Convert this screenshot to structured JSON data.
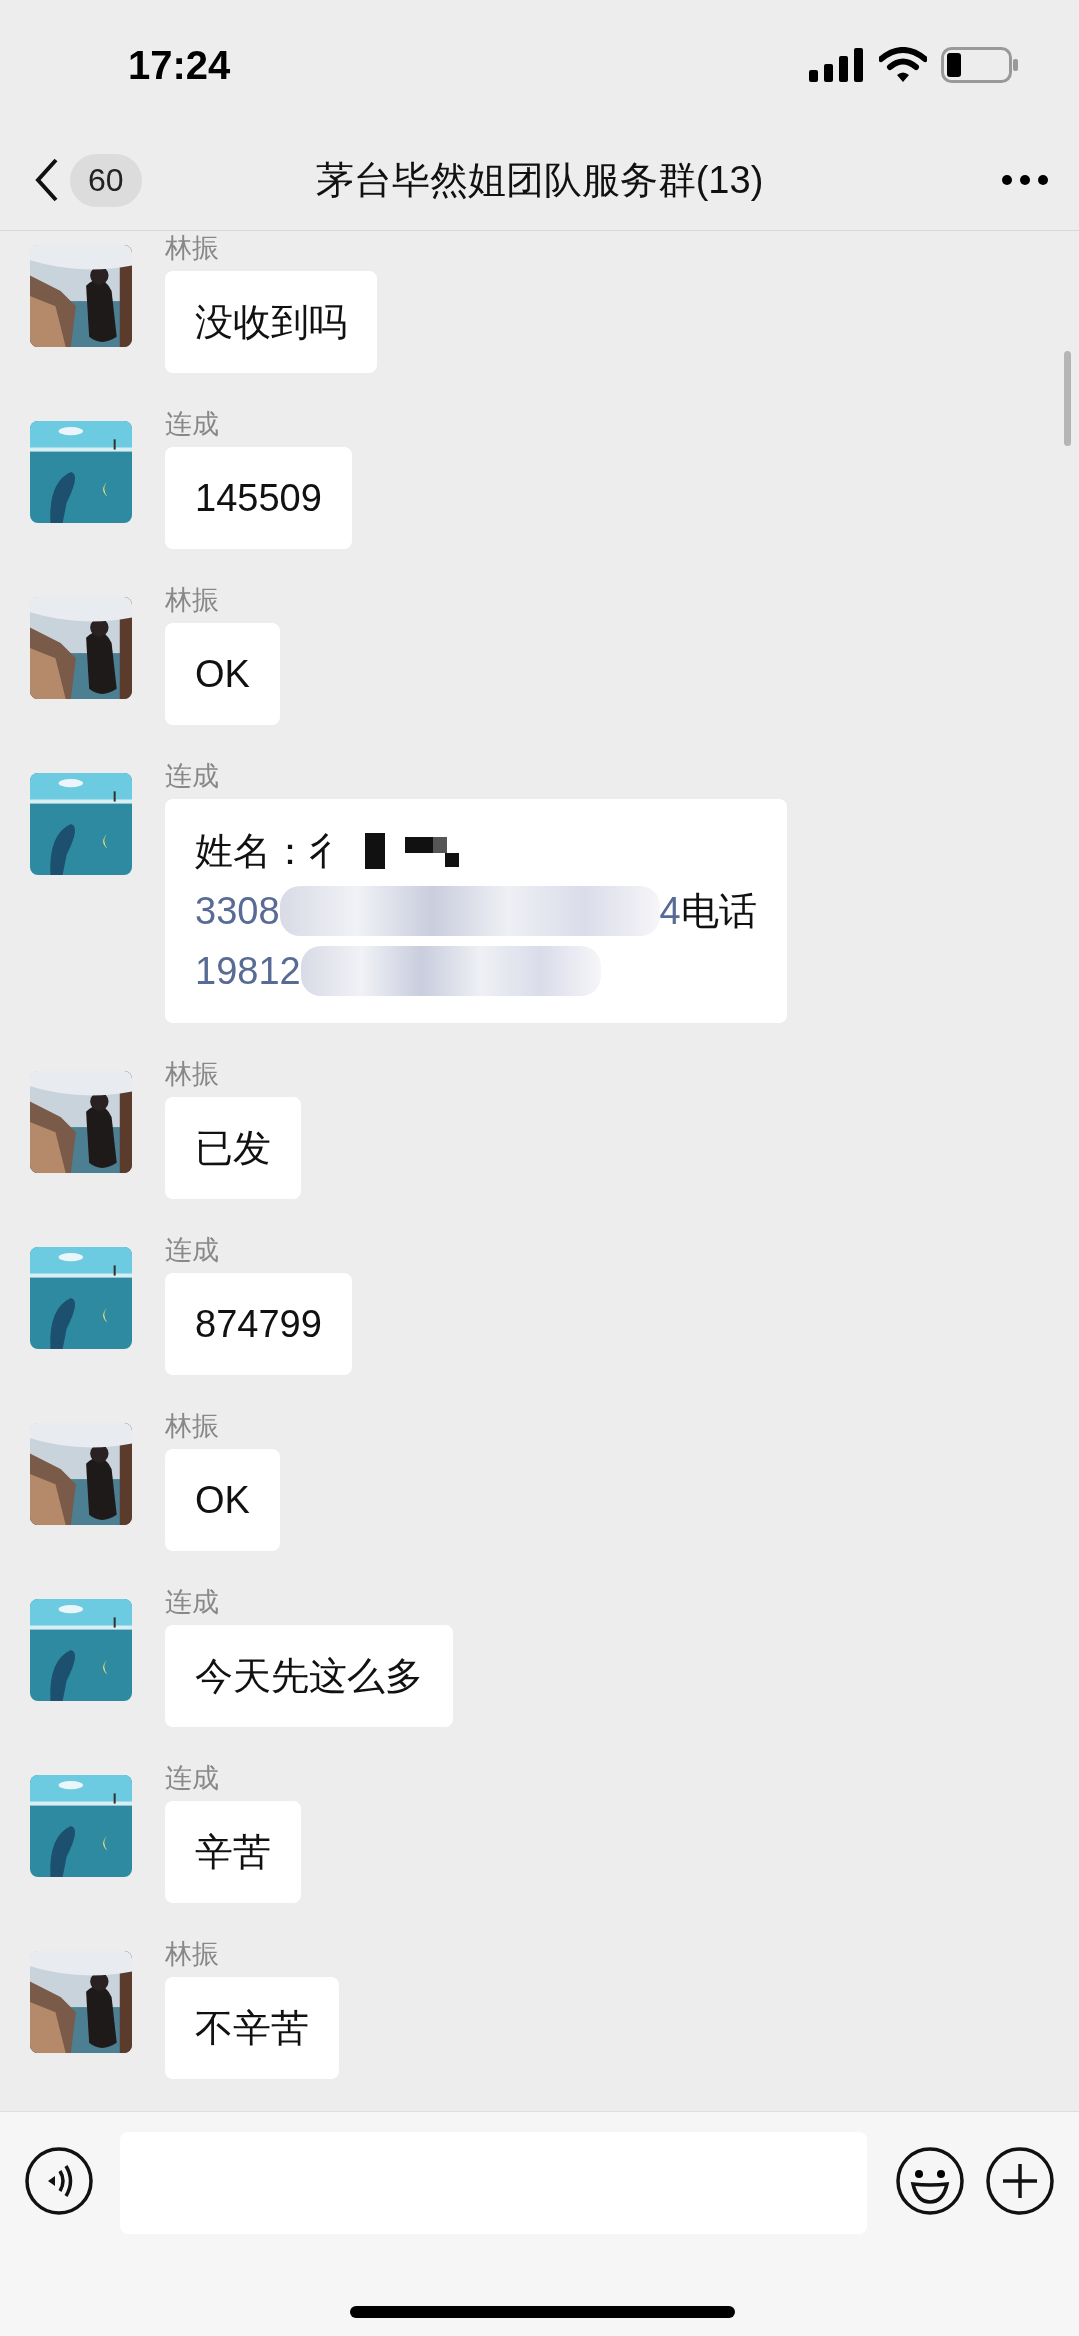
{
  "status_bar": {
    "time": "17:24"
  },
  "nav": {
    "back_badge": "60",
    "title": "茅台毕然姐团队服务群(13)"
  },
  "messages": [
    {
      "sender": "林振",
      "kind": "text",
      "text": "没收到吗"
    },
    {
      "sender": "连成",
      "kind": "text",
      "text": "145509"
    },
    {
      "sender": "林振",
      "kind": "text",
      "text": "OK"
    },
    {
      "sender": "连成",
      "kind": "redacted",
      "lines": [
        [
          {
            "kind": "text",
            "text": "姓名：彳"
          },
          {
            "kind": "mask"
          }
        ],
        [
          {
            "kind": "link",
            "text": "3308"
          },
          {
            "kind": "mask"
          },
          {
            "kind": "link",
            "text": "4"
          },
          {
            "kind": "text",
            "text": "电话"
          }
        ],
        [
          {
            "kind": "link",
            "text": "19812"
          },
          {
            "kind": "mask"
          }
        ]
      ]
    },
    {
      "sender": "林振",
      "kind": "text",
      "text": "已发"
    },
    {
      "sender": "连成",
      "kind": "text",
      "text": "874799"
    },
    {
      "sender": "林振",
      "kind": "text",
      "text": "OK"
    },
    {
      "sender": "连成",
      "kind": "text",
      "text": "今天先这么多"
    },
    {
      "sender": "连成",
      "kind": "text",
      "text": "辛苦"
    },
    {
      "sender": "林振",
      "kind": "text",
      "text": "不辛苦"
    }
  ]
}
